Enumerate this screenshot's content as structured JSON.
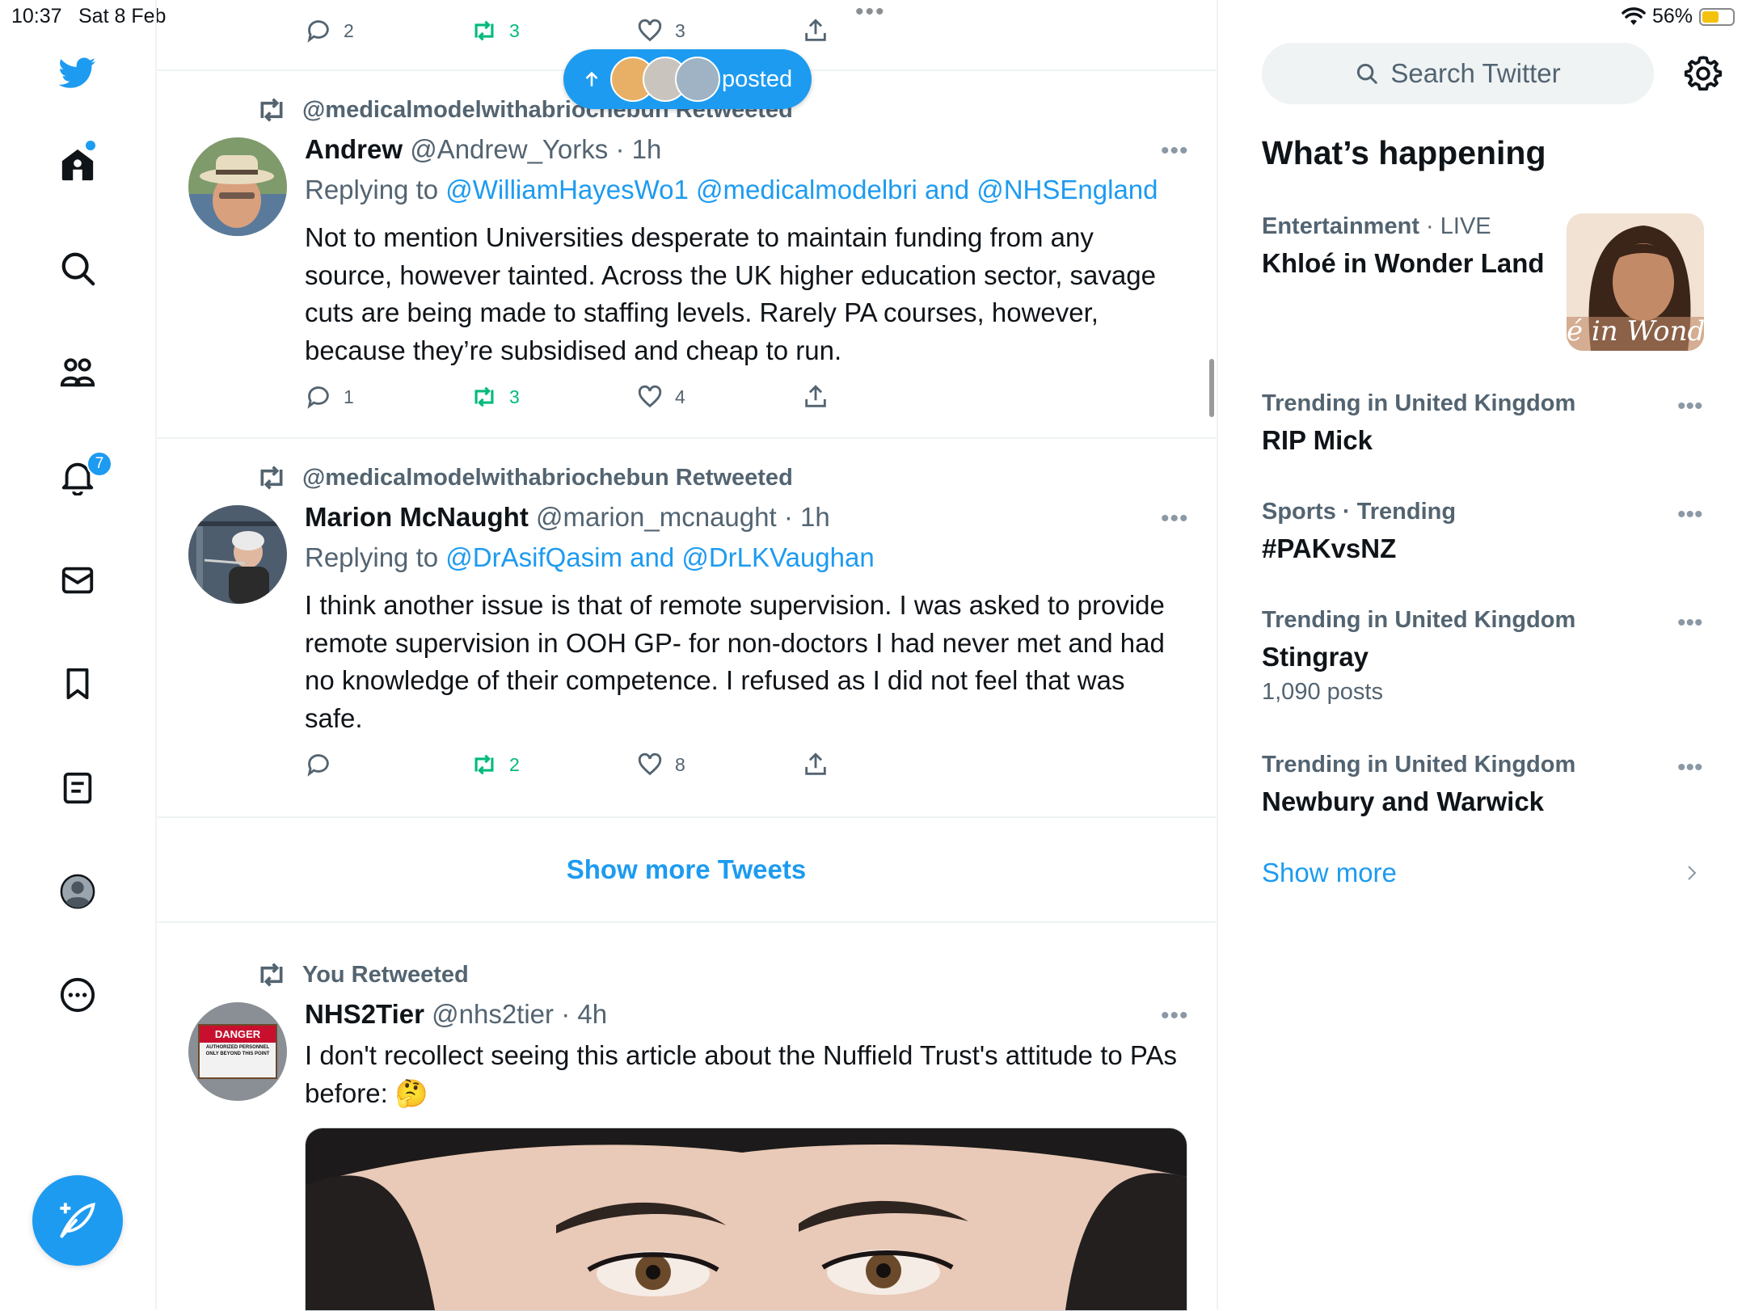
{
  "status_bar": {
    "time": "10:37",
    "date": "Sat 8 Feb",
    "battery_percent": "56%",
    "battery_level": 0.56
  },
  "colors": {
    "accent": "#1d9bf0",
    "retweet_green": "#00ba7c",
    "secondary_text": "#536471",
    "divider": "#eff3f4"
  },
  "nav": {
    "items": [
      {
        "icon": "twitter-bird-icon"
      },
      {
        "icon": "home-icon"
      },
      {
        "icon": "search-icon"
      },
      {
        "icon": "communities-icon"
      },
      {
        "icon": "notifications-icon"
      },
      {
        "icon": "messages-icon"
      },
      {
        "icon": "bookmarks-icon"
      },
      {
        "icon": "lists-icon"
      },
      {
        "icon": "profile-icon"
      },
      {
        "icon": "more-icon"
      }
    ],
    "notifications_badge": "7",
    "compose_icon": "compose-feather-icon"
  },
  "new_posts_pill": {
    "label": "posted"
  },
  "previous_tweet_actions": {
    "replies": "2",
    "retweets": "3",
    "likes": "3"
  },
  "tweets": [
    {
      "retweeted_by": "@medicalmodelwithabriochebun Retweeted",
      "name": "Andrew",
      "handle": "@Andrew_Yorks",
      "time": "· 1h",
      "replying_prefix": "Replying to",
      "replying_to": "@WilliamHayesWo1 @medicalmodelbri and @NHSEngland",
      "text": "Not to mention Universities desperate to maintain funding from any source, however tainted. Across the UK higher education sector, savage cuts are being made to staffing levels. Rarely PA courses, however, because they’re subsidised and cheap to run.",
      "replies": "1",
      "retweets": "3",
      "likes": "4"
    },
    {
      "retweeted_by": "@medicalmodelwithabriochebun Retweeted",
      "name": "Marion McNaught",
      "handle": "@marion_mcnaught",
      "time": "· 1h",
      "replying_prefix": "Replying to",
      "replying_to": "@DrAsifQasim and @DrLKVaughan",
      "text": "I think another issue is that of remote supervision. I was asked to provide remote supervision in OOH GP- for non-doctors I had never met and had no knowledge of their competence. I refused as I did not feel that was safe.",
      "replies": "",
      "retweets": "2",
      "likes": "8"
    },
    {
      "retweeted_by": "You Retweeted",
      "name": "NHS2Tier",
      "handle": "@nhs2tier",
      "time": "· 4h",
      "text": "I don't recollect seeing this article about the Nuffield Trust's attitude to PAs before: 🤔",
      "avatar_sign": "DANGER",
      "avatar_sign_sub": "AUTHORIZED PERSONNEL ONLY BEYOND THIS POINT"
    }
  ],
  "show_more_tweets": "Show more Tweets",
  "sidebar": {
    "search_placeholder": "Search Twitter",
    "settings_icon": "gear-icon",
    "whats_happening": "What’s happening",
    "featured": {
      "category": "Entertainment",
      "live": "· LIVE",
      "title": "Khloé in Wonder Land",
      "image_text": "é in Wonder L"
    },
    "trends": [
      {
        "meta": "Trending in United Kingdom",
        "title": "RIP Mick",
        "count": ""
      },
      {
        "meta": "Sports · Trending",
        "title": "#PAKvsNZ",
        "count": ""
      },
      {
        "meta": "Trending in United Kingdom",
        "title": "Stingray",
        "count": "1,090 posts"
      },
      {
        "meta": "Trending in United Kingdom",
        "title": "Newbury and Warwick",
        "count": ""
      }
    ],
    "show_more": "Show more"
  }
}
